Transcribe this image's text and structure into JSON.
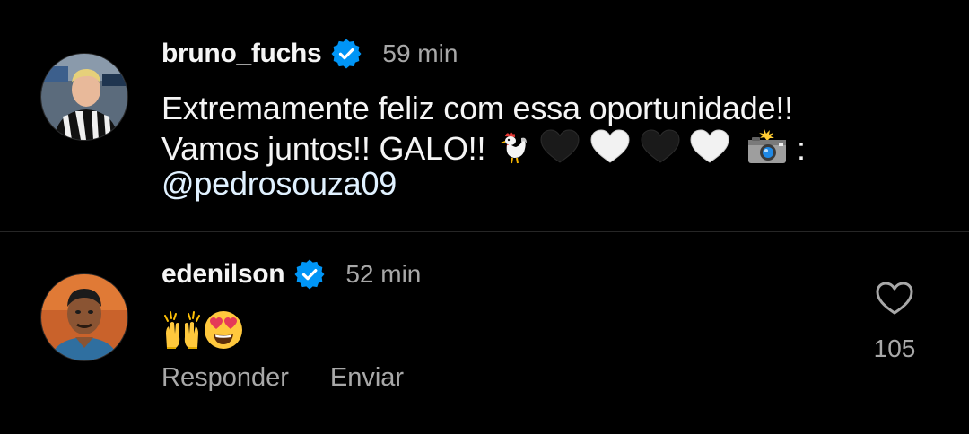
{
  "post": {
    "username": "bruno_fuchs",
    "verified": true,
    "timestamp": "59 min",
    "text_line1": "Extremamente feliz com essa oportunidade!!",
    "text_line2_start": "Vamos juntos!! GALO!!",
    "text_line2_end": ":",
    "mention": "@pedrosouza09",
    "emojis": [
      "rooster-emoji",
      "black-heart-emoji",
      "white-heart-emoji",
      "black-heart-emoji",
      "white-heart-emoji",
      "camera-with-flash-emoji"
    ]
  },
  "comment": {
    "username": "edenilson",
    "verified": true,
    "timestamp": "52 min",
    "emojis": [
      "raising-hands-emoji",
      "heart-eyes-emoji"
    ],
    "reply_label": "Responder",
    "send_label": "Enviar",
    "like_count": "105"
  },
  "colors": {
    "background": "#000000",
    "text_primary": "#f5f5f5",
    "text_secondary": "#a8a8a8",
    "verified_blue": "#0095f6",
    "divider": "#262626"
  }
}
